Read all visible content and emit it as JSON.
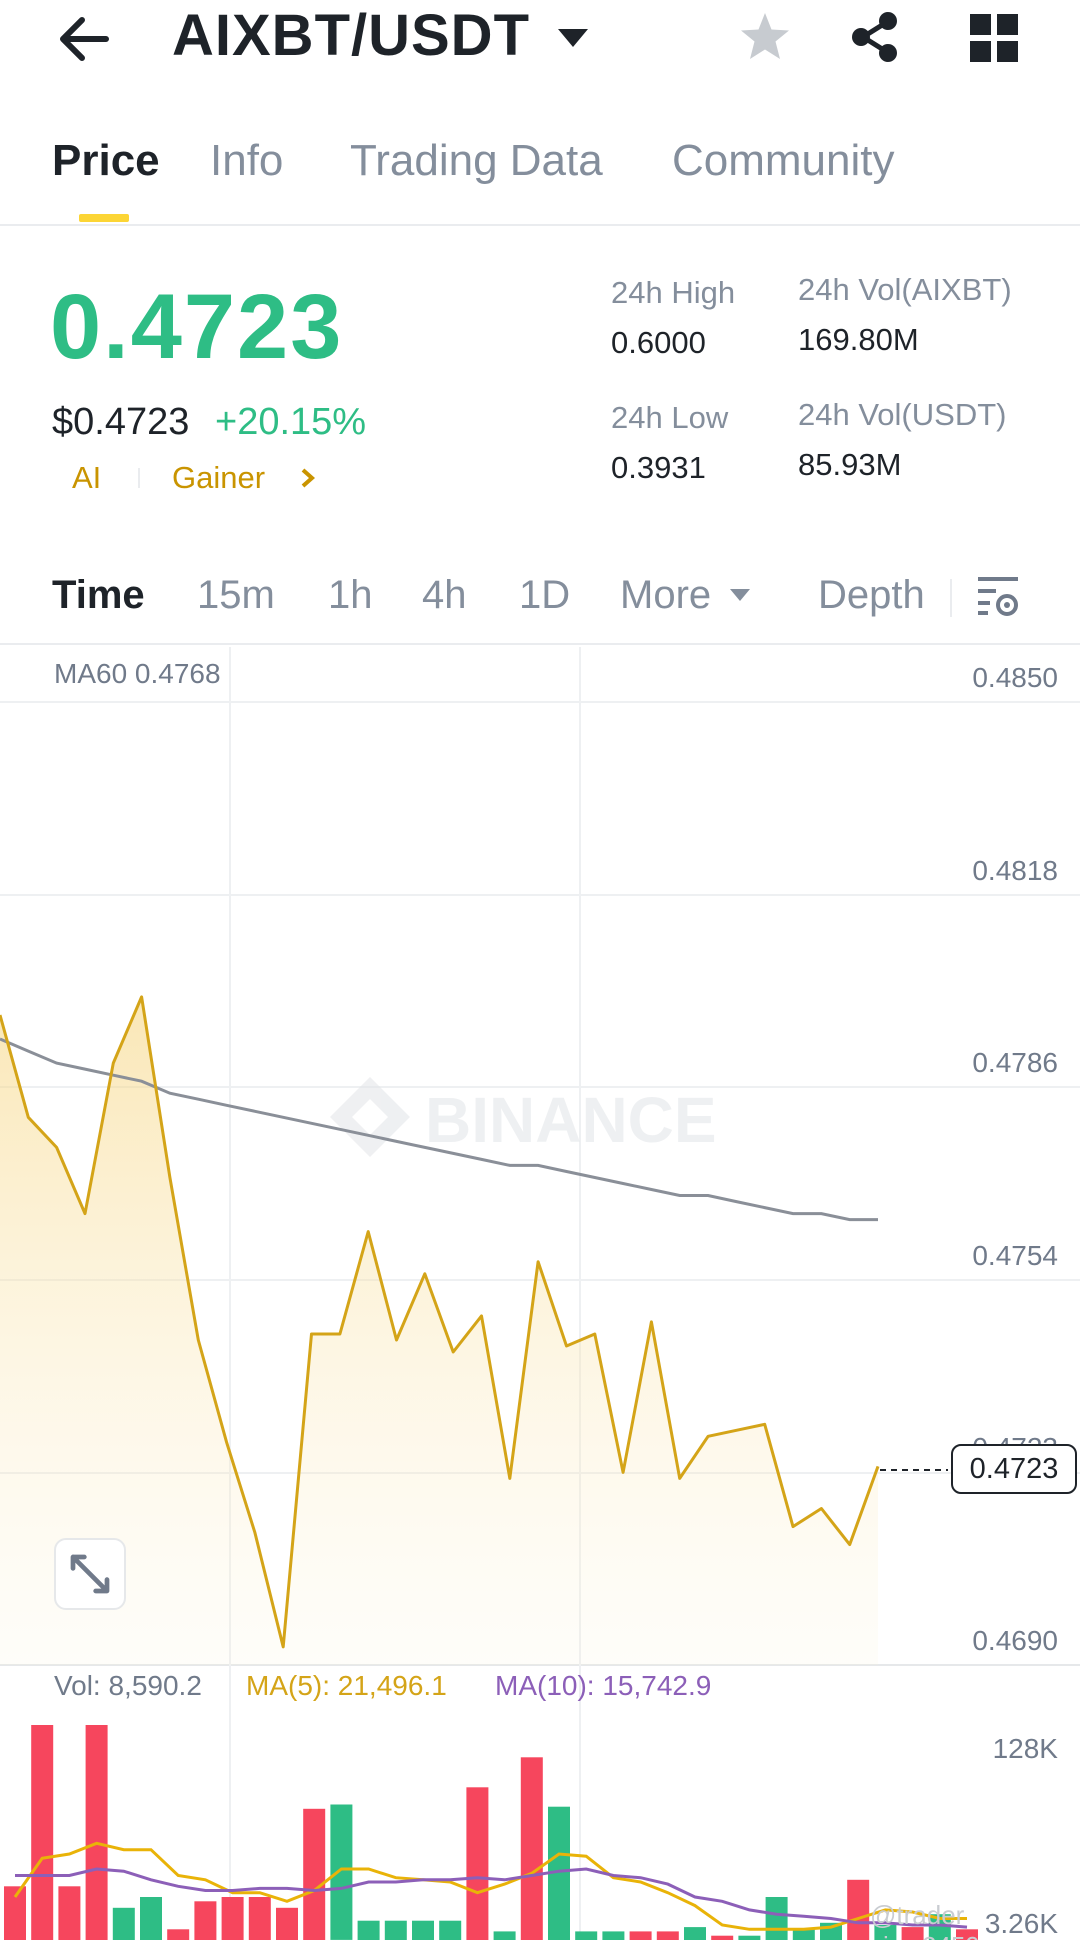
{
  "header": {
    "pair": "AIXBT/USDT"
  },
  "tabs": [
    "Price",
    "Info",
    "Trading Data",
    "Community"
  ],
  "ticker": {
    "last_price": "0.4723",
    "usd_price": "$0.4723",
    "change_pct": "+20.15%",
    "tags": [
      "AI",
      "Gainer"
    ],
    "high_label": "24h High",
    "high": "0.6000",
    "low_label": "24h Low",
    "low": "0.3931",
    "vol_base_label": "24h Vol(AIXBT)",
    "vol_base": "169.80M",
    "vol_quote_label": "24h Vol(USDT)",
    "vol_quote": "85.93M"
  },
  "intervals": {
    "items": [
      "Time",
      "15m",
      "1h",
      "4h",
      "1D",
      "More"
    ],
    "depth": "Depth"
  },
  "chart": {
    "ma60_label": "MA60 0.4768",
    "price_axis": [
      "0.4850",
      "0.4818",
      "0.4786",
      "0.4754",
      "0.4723",
      "0.4690"
    ],
    "current_price_tag": "0.4723",
    "watermark": "BINANCE",
    "vol_label": "Vol: 8,590.2",
    "vol_ma5_label": "MA(5): 21,496.1",
    "vol_ma10_label": "MA(10): 15,742.9",
    "vol_axis_top": "128K",
    "vol_axis_bottom": "3.26K",
    "credit": "@trader view2459",
    "colors": {
      "up": "#2ebd85",
      "down": "#f6465d",
      "price_line": "#d4a418",
      "ma60": "#8a8f98",
      "ma5": "#e9b308",
      "ma10": "#8c5fb8"
    }
  },
  "chart_data": {
    "type": "line",
    "y_axis_labels": [
      0.485,
      0.4818,
      0.4786,
      0.4754,
      0.4723,
      0.469
    ],
    "ylim": [
      0.469,
      0.485
    ],
    "series": [
      {
        "name": "Price",
        "values": [
          0.4798,
          0.4781,
          0.4776,
          0.4765,
          0.479,
          0.4801,
          0.4771,
          0.4744,
          0.4727,
          0.4712,
          0.4693,
          0.4745,
          0.4745,
          0.4762,
          0.4744,
          0.4755,
          0.4742,
          0.4748,
          0.4721,
          0.4757,
          0.4743,
          0.4745,
          0.4722,
          0.4747,
          0.4721,
          0.4728,
          0.4729,
          0.473,
          0.4713,
          0.4716,
          0.471,
          0.4723
        ]
      },
      {
        "name": "MA60",
        "values": [
          0.4794,
          0.4792,
          0.479,
          0.4789,
          0.4788,
          0.4787,
          0.4785,
          0.4784,
          0.4783,
          0.4782,
          0.4781,
          0.478,
          0.4779,
          0.4778,
          0.4777,
          0.4776,
          0.4775,
          0.4774,
          0.4773,
          0.4773,
          0.4772,
          0.4771,
          0.477,
          0.4769,
          0.4768,
          0.4768,
          0.4767,
          0.4766,
          0.4765,
          0.4765,
          0.4764,
          0.4764
        ]
      }
    ],
    "volume": {
      "values": [
        0.25,
        1.0,
        0.25,
        1.0,
        0.15,
        0.2,
        0.05,
        0.18,
        0.2,
        0.2,
        0.15,
        0.61,
        0.63,
        0.09,
        0.09,
        0.09,
        0.09,
        0.71,
        0.04,
        0.85,
        0.62,
        0.04,
        0.04,
        0.04,
        0.04,
        0.06,
        0.02,
        0.02,
        0.2,
        0.05,
        0.08,
        0.28,
        0.07,
        0.06,
        0.12,
        0.05
      ],
      "up": [
        false,
        false,
        false,
        false,
        true,
        true,
        false,
        false,
        false,
        false,
        false,
        false,
        true,
        true,
        true,
        true,
        true,
        false,
        true,
        false,
        true,
        true,
        true,
        false,
        false,
        true,
        false,
        true,
        true,
        true,
        true,
        false,
        true,
        false,
        true,
        false
      ],
      "ma5": [
        0.2,
        0.38,
        0.4,
        0.45,
        0.42,
        0.42,
        0.3,
        0.28,
        0.22,
        0.22,
        0.18,
        0.23,
        0.33,
        0.33,
        0.29,
        0.28,
        0.27,
        0.22,
        0.26,
        0.31,
        0.4,
        0.39,
        0.29,
        0.27,
        0.22,
        0.16,
        0.07,
        0.05,
        0.05,
        0.05,
        0.06,
        0.1,
        0.14,
        0.13,
        0.1,
        0.1
      ],
      "ma10": [
        0.3,
        0.3,
        0.3,
        0.33,
        0.32,
        0.28,
        0.25,
        0.23,
        0.23,
        0.24,
        0.24,
        0.23,
        0.24,
        0.27,
        0.27,
        0.28,
        0.28,
        0.29,
        0.28,
        0.3,
        0.32,
        0.33,
        0.3,
        0.29,
        0.26,
        0.2,
        0.18,
        0.14,
        0.12,
        0.11,
        0.1,
        0.08,
        0.08,
        0.07,
        0.07,
        0.06
      ]
    }
  }
}
